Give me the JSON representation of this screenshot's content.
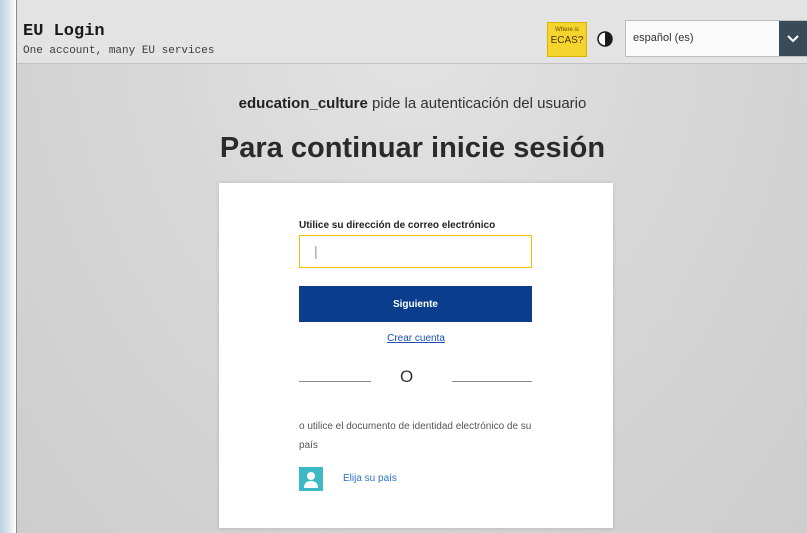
{
  "header": {
    "title": "EU Login",
    "subtitle": "One account, many EU services",
    "ecas_small": "Where is",
    "ecas_main": "ECAS?",
    "contrast_icon": "contrast-icon",
    "language": {
      "selected": "español (es)"
    }
  },
  "main": {
    "auth_app": "education_culture",
    "auth_rest": " pide la autenticación del usuario",
    "title": "Para continuar inicie sesión"
  },
  "form": {
    "email_label": "Utilice su dirección de correo electrónico",
    "email_value": "|",
    "next_label": "Siguiente",
    "create_account": "Crear cuenta",
    "or_text": "O",
    "eid_text": "o utilice el documento de identidad electrónico de su país",
    "choose_country": "Elija su país",
    "country_icon": "person-icon"
  },
  "colors": {
    "primary_button": "#0a3e8c",
    "ecas_badge": "#f6d42e",
    "input_border": "#f2c200",
    "country_icon_bg": "#3cb9c5"
  }
}
